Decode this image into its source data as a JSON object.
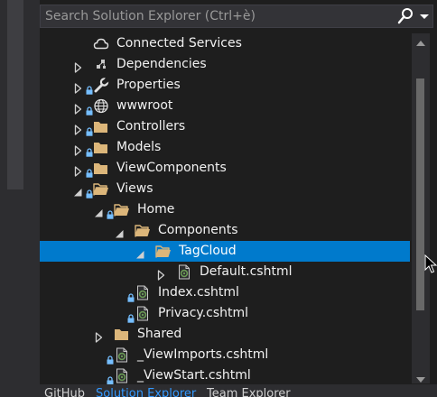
{
  "search": {
    "placeholder": "Search Solution Explorer (Ctrl+è)"
  },
  "tree": [
    {
      "label": "Connected Services",
      "icon": "connected-services-icon",
      "depth": 1,
      "expander": "none",
      "lock": false
    },
    {
      "label": "Dependencies",
      "icon": "dependencies-icon",
      "depth": 1,
      "expander": "collapsed",
      "lock": false
    },
    {
      "label": "Properties",
      "icon": "wrench-icon",
      "depth": 1,
      "expander": "collapsed",
      "lock": true
    },
    {
      "label": "wwwroot",
      "icon": "globe-icon",
      "depth": 1,
      "expander": "collapsed",
      "lock": true
    },
    {
      "label": "Controllers",
      "icon": "folder-icon",
      "depth": 1,
      "expander": "collapsed",
      "lock": true
    },
    {
      "label": "Models",
      "icon": "folder-icon",
      "depth": 1,
      "expander": "collapsed",
      "lock": true
    },
    {
      "label": "ViewComponents",
      "icon": "folder-icon",
      "depth": 1,
      "expander": "collapsed",
      "lock": true
    },
    {
      "label": "Views",
      "icon": "folder-open-icon",
      "depth": 1,
      "expander": "expanded",
      "lock": true
    },
    {
      "label": "Home",
      "icon": "folder-open-icon",
      "depth": 2,
      "expander": "expanded",
      "lock": true
    },
    {
      "label": "Components",
      "icon": "folder-open-icon",
      "depth": 3,
      "expander": "expanded",
      "lock": false
    },
    {
      "label": "TagCloud",
      "icon": "folder-open-icon",
      "depth": 4,
      "expander": "expanded",
      "lock": false,
      "selected": true
    },
    {
      "label": "Default.cshtml",
      "icon": "razor-file-icon",
      "depth": 5,
      "expander": "collapsed",
      "lock": false
    },
    {
      "label": "Index.cshtml",
      "icon": "razor-file-icon",
      "depth": 3,
      "expander": "none",
      "lock": true
    },
    {
      "label": "Privacy.cshtml",
      "icon": "razor-file-icon",
      "depth": 3,
      "expander": "none",
      "lock": true
    },
    {
      "label": "Shared",
      "icon": "folder-icon",
      "depth": 2,
      "expander": "collapsed",
      "lock": false
    },
    {
      "label": "_ViewImports.cshtml",
      "icon": "razor-file-icon",
      "depth": 2,
      "expander": "none",
      "lock": true
    },
    {
      "label": "_ViewStart.cshtml",
      "icon": "razor-file-icon",
      "depth": 2,
      "expander": "none",
      "lock": true
    }
  ],
  "bottom_tabs": [
    {
      "label": "GitHub",
      "active": false
    },
    {
      "label": "Solution Explorer",
      "active": true
    },
    {
      "label": "Team Explorer",
      "active": false
    }
  ],
  "colors": {
    "background": "#1e1e1e",
    "selection": "#007acc",
    "folder": "#dcb67a",
    "lock": "#75beff",
    "razor": "#6a9955"
  }
}
